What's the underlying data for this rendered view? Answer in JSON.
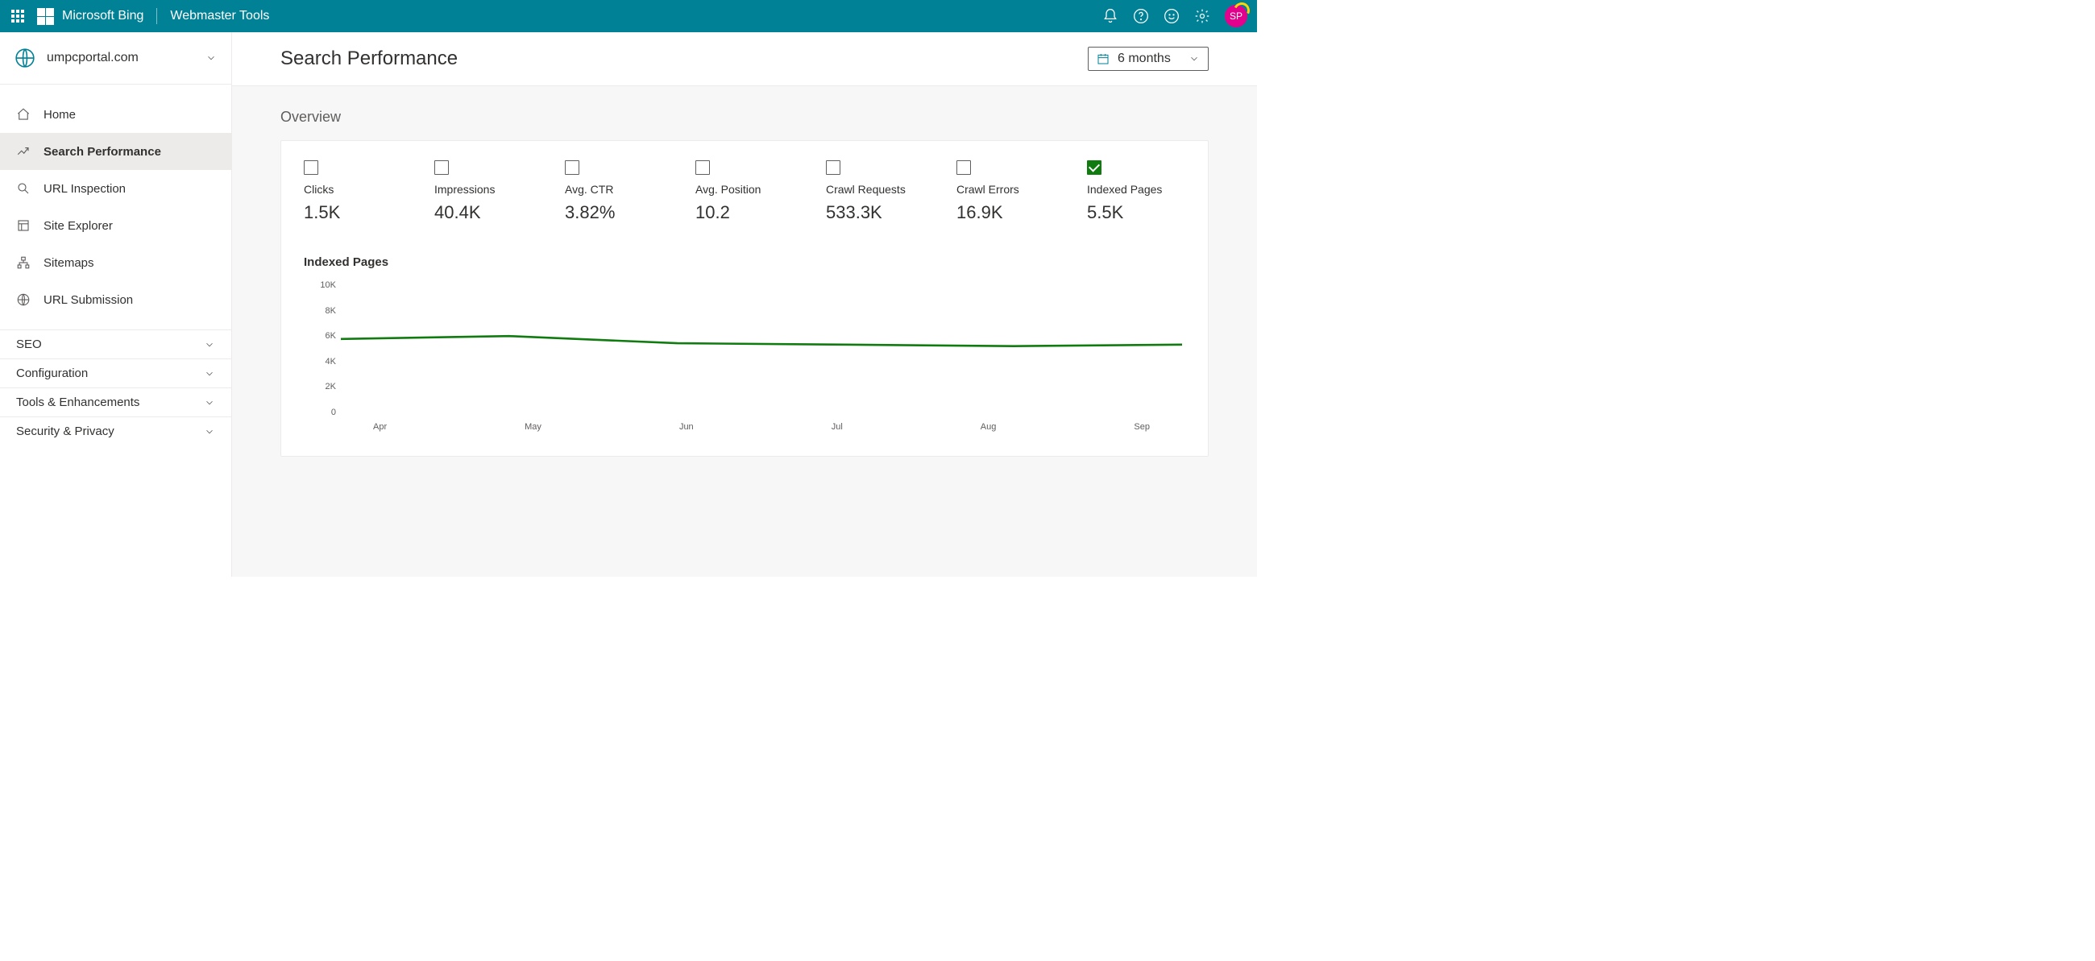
{
  "header": {
    "brand": "Microsoft Bing",
    "app": "Webmaster Tools",
    "avatar": "SP"
  },
  "site": {
    "domain": "umpcportal.com"
  },
  "nav": {
    "items": [
      {
        "label": "Home"
      },
      {
        "label": "Search Performance"
      },
      {
        "label": "URL Inspection"
      },
      {
        "label": "Site Explorer"
      },
      {
        "label": "Sitemaps"
      },
      {
        "label": "URL Submission"
      }
    ],
    "sections": [
      {
        "label": "SEO"
      },
      {
        "label": "Configuration"
      },
      {
        "label": "Tools & Enhancements"
      },
      {
        "label": "Security & Privacy"
      }
    ]
  },
  "page": {
    "title": "Search Performance",
    "range": "6 months",
    "overview": "Overview"
  },
  "metrics": [
    {
      "label": "Clicks",
      "value": "1.5K",
      "checked": false
    },
    {
      "label": "Impressions",
      "value": "40.4K",
      "checked": false
    },
    {
      "label": "Avg. CTR",
      "value": "3.82%",
      "checked": false
    },
    {
      "label": "Avg. Position",
      "value": "10.2",
      "checked": false
    },
    {
      "label": "Crawl Requests",
      "value": "533.3K",
      "checked": false
    },
    {
      "label": "Crawl Errors",
      "value": "16.9K",
      "checked": false
    },
    {
      "label": "Indexed Pages",
      "value": "5.5K",
      "checked": true
    }
  ],
  "chart": {
    "title": "Indexed Pages"
  },
  "chart_data": {
    "type": "line",
    "title": "Indexed Pages",
    "xlabel": "",
    "ylabel": "",
    "ylim": [
      0,
      10000
    ],
    "y_ticks": [
      "10K",
      "8K",
      "6K",
      "4K",
      "2K",
      "0"
    ],
    "categories": [
      "Apr",
      "May",
      "Jun",
      "Jul",
      "Aug",
      "Sep"
    ],
    "series": [
      {
        "name": "Indexed Pages",
        "color": "#107c10",
        "values": [
          5900,
          6100,
          5600,
          5500,
          5400,
          5500
        ]
      }
    ]
  }
}
